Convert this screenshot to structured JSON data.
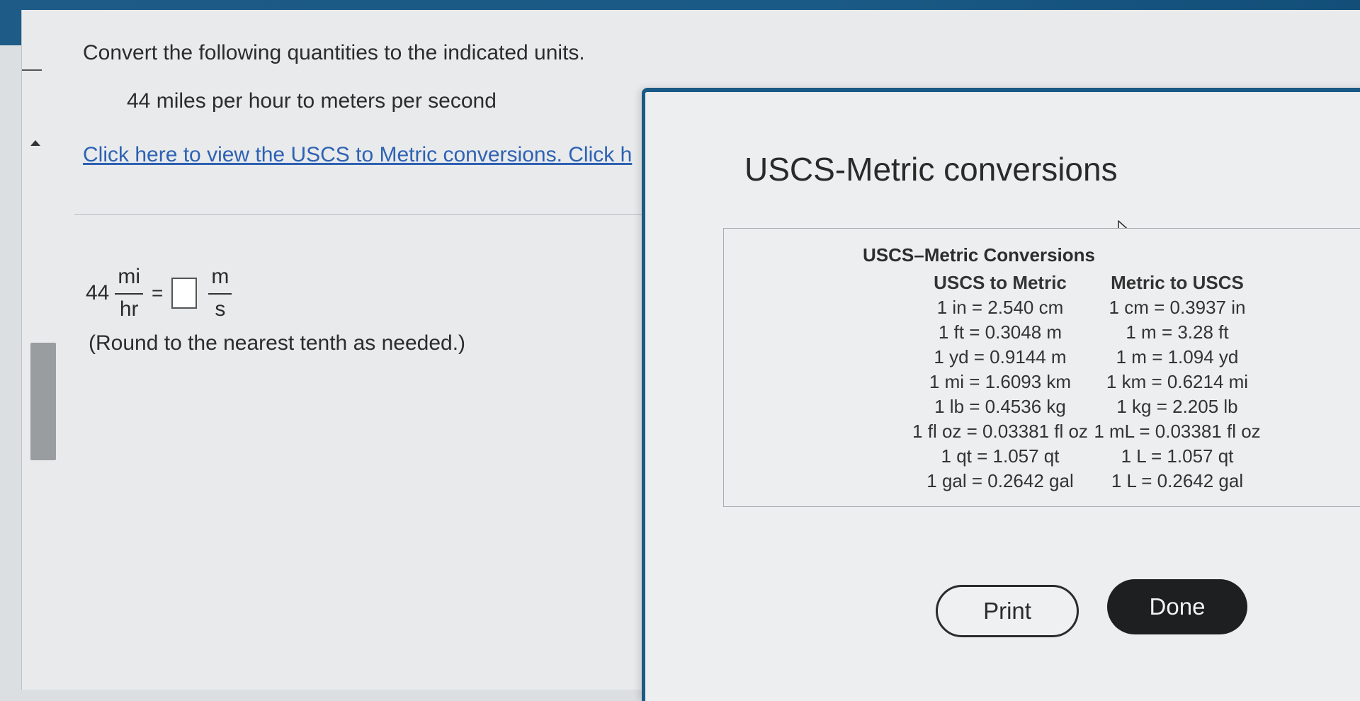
{
  "question": {
    "instruction": "Convert the following quantities to the indicated units.",
    "prompt": "44 miles per hour to meters per second",
    "link_text": "Click here to view the USCS to Metric conversions. Click h",
    "equation": {
      "value": "44",
      "from_num": "mi",
      "from_den": "hr",
      "equals": "=",
      "to_num": "m",
      "to_den": "s"
    },
    "round_note": "(Round to the nearest tenth as needed.)"
  },
  "dialog": {
    "title": "USCS-Metric conversions",
    "table": {
      "title": "USCS–Metric Conversions",
      "left_header": "USCS to Metric",
      "right_header": "Metric to USCS",
      "left_rows": [
        "1 in = 2.540 cm",
        "1 ft = 0.3048 m",
        "1 yd = 0.9144 m",
        "1 mi = 1.6093 km",
        "1 lb = 0.4536 kg",
        "1 fl oz = 0.03381 fl oz",
        "1 qt = 1.057 qt",
        "1 gal = 0.2642 gal"
      ],
      "right_rows": [
        "1 cm = 0.3937 in",
        "1 m = 3.28 ft",
        "1 m = 1.094 yd",
        "1 km = 0.6214 mi",
        "1 kg = 2.205 lb",
        "1 mL = 0.03381 fl oz",
        "1 L = 1.057 qt",
        "1 L = 0.2642 gal"
      ]
    },
    "print_label": "Print",
    "done_label": "Done"
  },
  "colors": {
    "header_blue": "#1a5a86",
    "link_blue": "#2e62b3",
    "done_button": "#1d1f21"
  }
}
